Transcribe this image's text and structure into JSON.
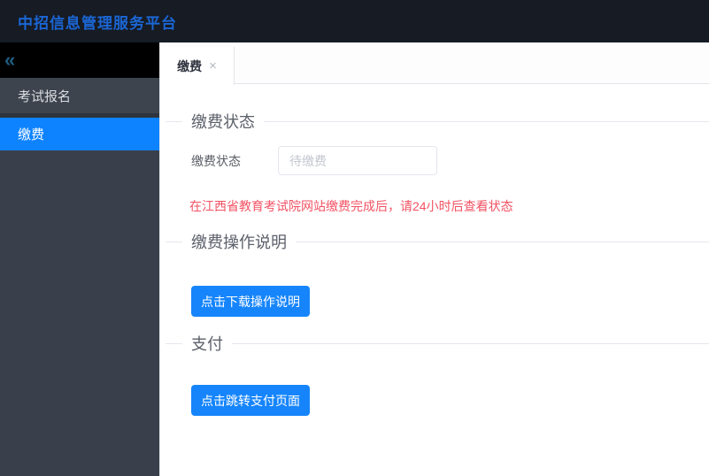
{
  "app": {
    "title": "中招信息管理服务平台"
  },
  "sidebar": {
    "collapse_icon": "«",
    "items": [
      {
        "label": "考试报名",
        "active": false
      },
      {
        "label": "缴费",
        "active": true
      }
    ]
  },
  "tabs": [
    {
      "label": "缴费",
      "close_glyph": "×"
    }
  ],
  "main": {
    "status_section": {
      "heading": "缴费状态",
      "field_label": "缴费状态",
      "field_value": "待缴费"
    },
    "notice": "在江西省教育考试院网站缴费完成后，请24小时后查看状态",
    "instructions_section": {
      "heading": "缴费操作说明",
      "download_button": "点击下载操作说明"
    },
    "payment_section": {
      "heading": "支付",
      "pay_button": "点击跳转支付页面"
    }
  },
  "colors": {
    "topbar_bg": "#161b24",
    "title_blue": "#1b66d4",
    "sidebar_bg": "#3a404b",
    "menu_active_blue": "#0e83ff",
    "button_blue": "#1685fc",
    "notice_red": "#f25263",
    "divider_line": "#e4e7ed"
  }
}
